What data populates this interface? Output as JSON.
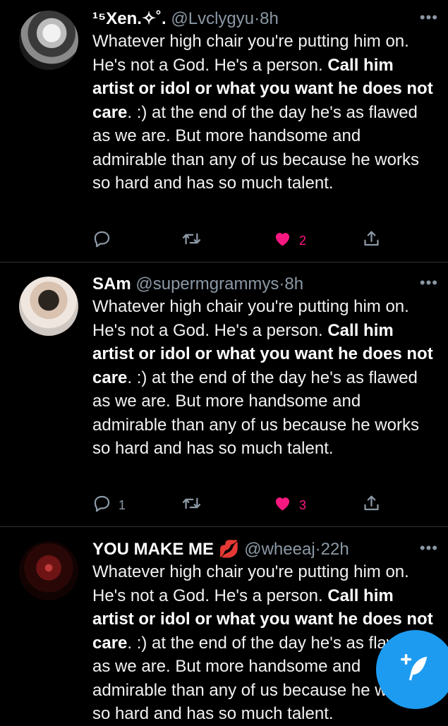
{
  "tweets": [
    {
      "name": "¹⁵Xen.✧˚.",
      "handle": "@Lvclygyu",
      "time": "8h",
      "text_1": "Whatever high chair you're putting him on. He's not a God. He's a person. ",
      "text_bold": "Call him artist or idol or what you want he does not care",
      "text_2": ". :) at the end of the day he's as flawed as we are. But more handsome and admirable than any of us because he works so hard and has so much talent.",
      "reply_count": "",
      "like_count": "2"
    },
    {
      "name": "SAm",
      "handle": "@supermgrammys",
      "time": "8h",
      "text_1": "Whatever high chair you're putting him on. He's not a God. He's a person. ",
      "text_bold": "Call him artist or idol or what you want he does not care",
      "text_2": ". :) at the end of the day he's as flawed as we are. But more handsome and admirable than any of us because he works so hard and has so much talent.",
      "reply_count": "1",
      "like_count": "3"
    },
    {
      "name": "YOU MAKE ME 💋",
      "handle": "@wheeaj",
      "time": "22h",
      "text_1": "Whatever high chair you're putting him on. He's not a God. He's a person. ",
      "text_bold": "Call him artist or idol or what you want he does not care",
      "text_2": ". :) at the end of the day he's as flawed as we are. But more handsome and admirable than any of us because he works so hard and has so much talent.",
      "reply_count": "",
      "like_count": ""
    }
  ],
  "sep": "·",
  "more_glyph": "•••",
  "colors": {
    "background": "#000000",
    "like": "#f91880",
    "accent": "#1d9bf0",
    "secondary": "#8b98a5"
  },
  "icons": [
    "reply-icon",
    "retweet-icon",
    "like-icon",
    "share-icon",
    "compose-icon"
  ]
}
